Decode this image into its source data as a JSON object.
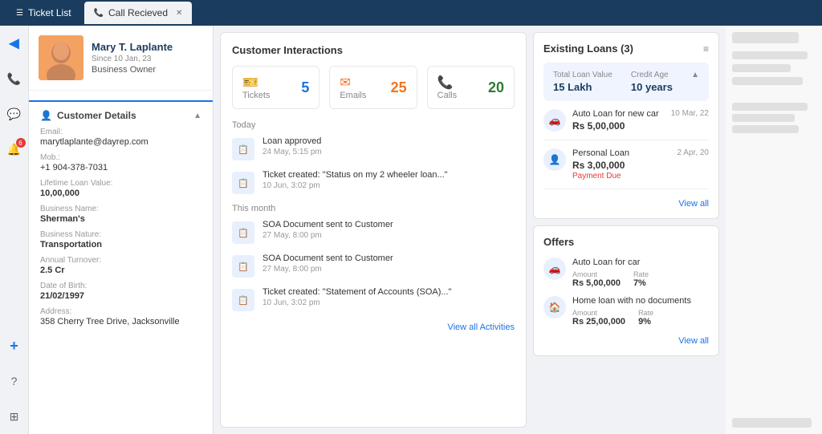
{
  "topbar": {
    "tabs": [
      {
        "id": "ticket-list",
        "label": "Ticket List",
        "icon": "☰",
        "active": false,
        "closable": false
      },
      {
        "id": "call-received",
        "label": "Call Recieved",
        "icon": "📞",
        "active": true,
        "closable": true
      }
    ]
  },
  "sidebar": {
    "icons": [
      {
        "id": "logo",
        "symbol": "◀",
        "active": false
      },
      {
        "id": "phone",
        "symbol": "📞",
        "active": false
      },
      {
        "id": "chat",
        "symbol": "💬",
        "active": false
      },
      {
        "id": "notification",
        "symbol": "🔔",
        "active": false,
        "badge": "6"
      },
      {
        "id": "add",
        "symbol": "+",
        "active": false
      },
      {
        "id": "help",
        "symbol": "?",
        "active": false
      },
      {
        "id": "grid",
        "symbol": "⊞",
        "active": false
      }
    ]
  },
  "customer": {
    "name": "Mary T. Laplante",
    "since": "Since 10 Jan, 23",
    "role": "Business Owner",
    "tabs": [
      "",
      "",
      ""
    ],
    "details_title": "Customer Details",
    "email_label": "Email:",
    "email": "marytlaplante@dayrep.com",
    "mob_label": "Mob.:",
    "mob": "+1 904-378-7031",
    "loan_value_label": "Lifetime Loan Value:",
    "loan_value": "10,00,000",
    "business_name_label": "Business Name:",
    "business_name": "Sherman's",
    "business_nature_label": "Business Nature:",
    "business_nature": "Transportation",
    "annual_turnover_label": "Annual Turnover:",
    "annual_turnover": "2.5 Cr",
    "dob_label": "Date of Birth:",
    "dob": "21/02/1997",
    "address_label": "Address:",
    "address": "358 Cherry Tree Drive, Jacksonville"
  },
  "interactions": {
    "title": "Customer Interactions",
    "stats": [
      {
        "id": "tickets",
        "label": "Tickets",
        "value": "5",
        "color": "blue",
        "icon": "🎫"
      },
      {
        "id": "emails",
        "label": "Emails",
        "value": "25",
        "color": "orange",
        "icon": "✉"
      },
      {
        "id": "calls",
        "label": "Calls",
        "value": "20",
        "color": "green",
        "icon": "📞"
      }
    ],
    "sections": [
      {
        "label": "Today",
        "activities": [
          {
            "id": "a1",
            "title": "Loan approved",
            "time": "24 May, 5:15 pm",
            "icon": "📋"
          },
          {
            "id": "a2",
            "title": "Ticket created: \"Status on my 2 wheeler loan...\"",
            "time": "10 Jun, 3:02 pm",
            "icon": "📋"
          }
        ]
      },
      {
        "label": "This month",
        "activities": [
          {
            "id": "a3",
            "title": "SOA Document sent to Customer",
            "time": "27 May, 8:00 pm",
            "icon": "📋"
          },
          {
            "id": "a4",
            "title": "SOA Document sent to Customer",
            "time": "27 May, 8:00 pm",
            "icon": "📋"
          },
          {
            "id": "a5",
            "title": "Ticket created: \"Statement of Accounts (SOA)...\"",
            "time": "10 Jun, 3:02 pm",
            "icon": "📋"
          }
        ]
      }
    ],
    "view_all": "View all Activities"
  },
  "loans": {
    "title": "Existing Loans (3)",
    "total_loan_value_label": "Total Loan Value",
    "total_loan_value": "15 Lakh",
    "credit_age_label": "Credit Age",
    "credit_age": "10 years",
    "items": [
      {
        "id": "loan1",
        "name": "Auto Loan for new car",
        "date": "10 Mar, 22",
        "amount": "Rs 5,00,000",
        "due": null,
        "icon": "🚗"
      },
      {
        "id": "loan2",
        "name": "Personal Loan",
        "date": "2 Apr, 20",
        "amount": "Rs 3,00,000",
        "due": "Payment Due",
        "icon": "👤"
      }
    ],
    "view_all": "View all"
  },
  "offers": {
    "title": "Offers",
    "items": [
      {
        "id": "offer1",
        "name": "Auto Loan for car",
        "amount_label": "Amount",
        "amount": "Rs 5,00,000",
        "rate_label": "Rate",
        "rate": "7%",
        "icon": "🚗"
      },
      {
        "id": "offer2",
        "name": "Home loan with no documents",
        "amount_label": "Amount",
        "amount": "Rs 25,00,000",
        "rate_label": "Rate",
        "rate": "9%",
        "icon": "🏠"
      }
    ],
    "view_all": "View all"
  },
  "placeholders": {
    "bars": [
      40,
      80,
      60,
      90,
      50,
      70
    ]
  }
}
